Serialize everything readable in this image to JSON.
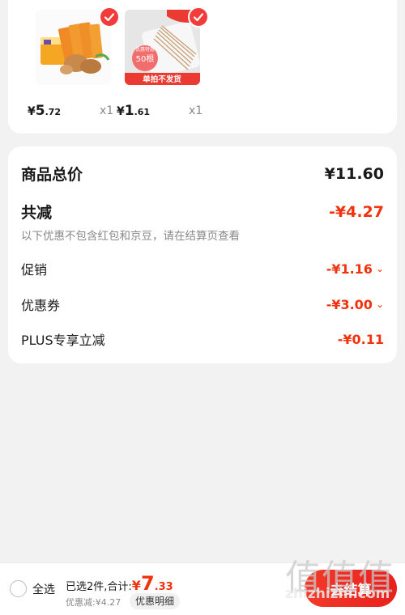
{
  "products": [
    {
      "price_yuan": "¥",
      "price_int": "5",
      "price_dec": ".72",
      "qty": "x1",
      "image": "sausage-pack",
      "selected": true
    },
    {
      "price_yuan": "¥",
      "price_int": "1",
      "price_dec": ".61",
      "qty": "x1",
      "image": "cotton-swabs",
      "selected": true,
      "img_badge": "50根",
      "img_note": "优惠特惠",
      "img_banner": "单拍不发货"
    }
  ],
  "summary": {
    "total_label": "商品总价",
    "total_value": "¥11.60",
    "reduce_label": "共减",
    "reduce_value": "-¥4.27",
    "note": "以下优惠不包含红包和京豆，请在结算页查看",
    "promo_label": "促销",
    "promo_value": "-¥1.16",
    "coupon_label": "优惠券",
    "coupon_value": "-¥3.00",
    "plus_label": "PLUS专享立减",
    "plus_value": "-¥0.11"
  },
  "bottom": {
    "select_all": "全选",
    "selected_text": "已选2件,合计:",
    "total_yuan": "¥",
    "total_int": "7",
    "total_dec": ".33",
    "discount": "优惠减:¥4.27",
    "detail_button": "优惠明细",
    "checkout_button": "去结算"
  },
  "watermark": {
    "chars": "值值值",
    "url": "zhizhizhi.com"
  },
  "colors": {
    "accent": "#f2320c",
    "checkout": "#ea2a1e"
  }
}
